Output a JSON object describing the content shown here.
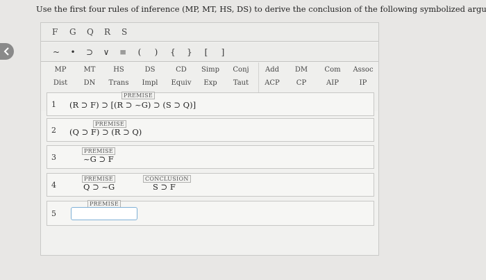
{
  "prompt": "Use the first four rules of inference (MP, MT, HS, DS) to derive the conclusion of the following symbolized argument.",
  "variables": [
    "F",
    "G",
    "Q",
    "R",
    "S"
  ],
  "symbols": [
    "~",
    "•",
    "⊃",
    "∨",
    "≡",
    "(",
    ")",
    "{",
    "}",
    "[",
    "]"
  ],
  "rules_row1": [
    "MP",
    "MT",
    "HS",
    "DS",
    "CD",
    "Simp",
    "Conj",
    "Add",
    "DM",
    "Com",
    "Assoc"
  ],
  "rules_row2": [
    "Dist",
    "DN",
    "Trans",
    "Impl",
    "Equiv",
    "Exp",
    "Taut",
    "ACP",
    "CP",
    "AIP",
    "IP"
  ],
  "lines": [
    {
      "num": "1",
      "tag": "PREMISE",
      "formula": "(R ⊃ F) ⊃ [(R ⊃ ~G) ⊃ (S ⊃ Q)]"
    },
    {
      "num": "2",
      "tag": "PREMISE",
      "formula": "(Q ⊃ F) ⊃ (R ⊃ Q)"
    },
    {
      "num": "3",
      "tag": "PREMISE",
      "formula": "~G ⊃ F"
    },
    {
      "num": "4",
      "tag": "PREMISE",
      "formula": "Q ⊃ ~G",
      "conclusion_tag": "CONCLUSION",
      "conclusion": "S ⊃ F"
    },
    {
      "num": "5",
      "tag": "PREMISE",
      "input_value": ""
    }
  ]
}
